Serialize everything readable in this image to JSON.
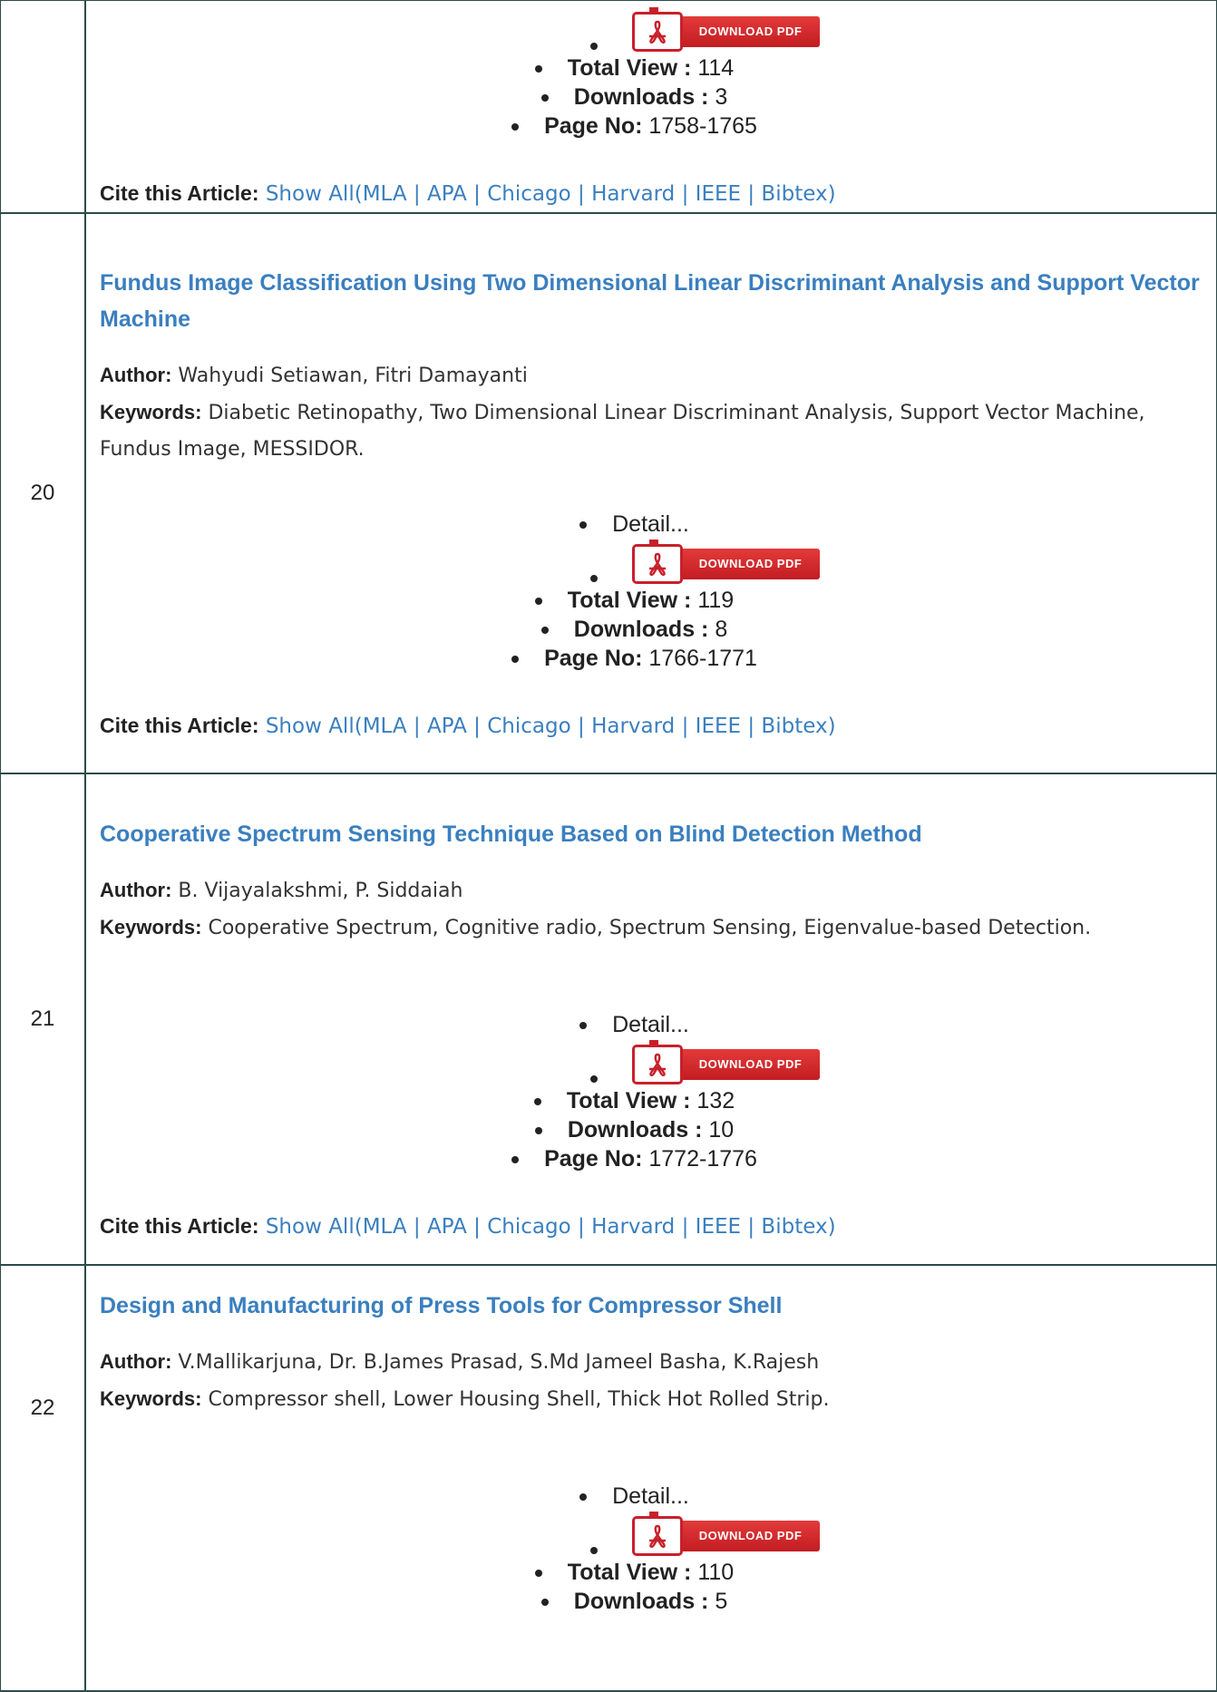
{
  "labels": {
    "author": "Author:",
    "keywords": "Keywords:",
    "detail": "Detail...",
    "download_pdf": "DOWNLOAD PDF",
    "total_view": "Total View :",
    "downloads": "Downloads :",
    "page_no": "Page No:",
    "cite": "Cite this Article:",
    "cite_show_all": "Show All",
    "cite_open": "(",
    "cite_sep": " | ",
    "cite_close": ")",
    "cite_mla": "MLA",
    "cite_apa": "APA",
    "cite_chicago": "Chicago",
    "cite_harvard": "Harvard",
    "cite_ieee": "IEEE",
    "cite_bibtex": "Bibtex"
  },
  "articles": [
    {
      "total_view": "114",
      "downloads": "3",
      "pages": "1758-1765"
    },
    {
      "number": "20",
      "title": "Fundus Image Classification Using Two Dimensional Linear Discriminant Analysis and Support Vector Machine",
      "authors": "Wahyudi Setiawan, Fitri Damayanti",
      "keywords": "Diabetic Retinopathy, Two Dimensional Linear Discriminant Analysis, Support Vector Machine, Fundus Image, MESSIDOR.",
      "total_view": "119",
      "downloads": "8",
      "pages": "1766-1771"
    },
    {
      "number": "21",
      "title": "Cooperative Spectrum Sensing Technique Based on Blind Detection Method",
      "authors": "B. Vijayalakshmi, P. Siddaiah",
      "keywords": "Cooperative Spectrum, Cognitive radio, Spectrum Sensing, Eigenvalue-based Detection.",
      "total_view": "132",
      "downloads": "10",
      "pages": "1772-1776"
    },
    {
      "number": "22",
      "title": "Design and Manufacturing of Press Tools for Compressor Shell",
      "authors": "V.Mallikarjuna, Dr. B.James Prasad, S.Md Jameel Basha, K.Rajesh",
      "keywords": "Compressor shell, Lower Housing Shell, Thick Hot Rolled Strip.",
      "total_view": "110",
      "downloads": "5"
    }
  ],
  "colors": {
    "link": "#3a7fbf",
    "pdf_red": "#c8202a",
    "border": "#2e4a4a"
  }
}
